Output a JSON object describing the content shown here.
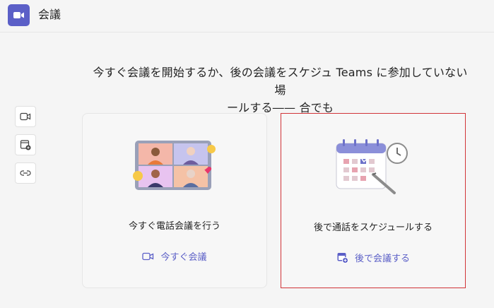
{
  "header": {
    "title": "会議",
    "app_icon": "video-camera-icon"
  },
  "headline": {
    "line1": "今すぐ会議を開始するか、後の会議をスケジュ Teams に参加していない場",
    "line2": "ールする―— 合でも"
  },
  "side_tools": [
    {
      "icon": "video-camera-icon"
    },
    {
      "icon": "calendar-add-icon"
    },
    {
      "icon": "link-icon"
    }
  ],
  "cards": {
    "meet_now": {
      "description": "今すぐ電話会議を行う",
      "action_label": "今すぐ会議",
      "action_icon": "video-camera-icon"
    },
    "schedule": {
      "description": "後で通話をスケジュールする",
      "action_label": "後で会議する",
      "action_icon": "calendar-add-icon"
    }
  },
  "colors": {
    "accent": "#5b5fc7",
    "selection_border": "#d13438"
  }
}
